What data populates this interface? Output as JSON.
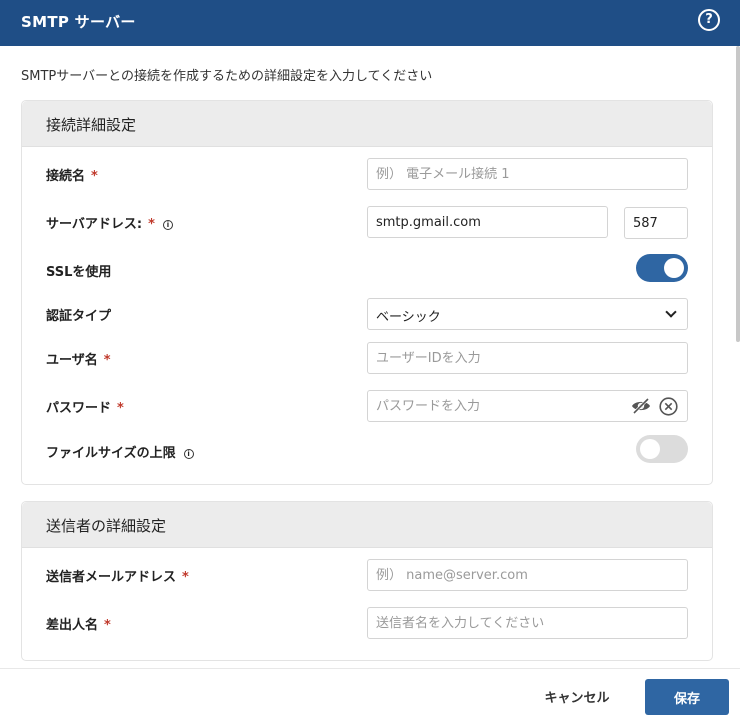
{
  "dialog": {
    "title": "SMTP サーバー",
    "help_icon": "?",
    "description": "SMTPサーバーとの接続を作成するための詳細設定を入力してください"
  },
  "connection_section": {
    "title": "接続詳細設定",
    "required_mark": "*",
    "info_mark": "i",
    "connection_name": {
      "label": "接続名",
      "placeholder": "例） 電子メール接続 1"
    },
    "server_address": {
      "label": "サーバアドレス:",
      "value": "smtp.gmail.com",
      "port": "587"
    },
    "ssl": {
      "label": "SSLを使用",
      "enabled": true
    },
    "auth_type": {
      "label": "認証タイプ",
      "value": "ベーシック"
    },
    "username": {
      "label": "ユーザ名",
      "placeholder": "ユーザーIDを入力"
    },
    "password": {
      "label": "パスワード",
      "placeholder": "パスワードを入力"
    },
    "file_size_limit": {
      "label": "ファイルサイズの上限",
      "enabled": false
    }
  },
  "sender_section": {
    "title": "送信者の詳細設定",
    "sender_email": {
      "label": "送信者メールアドレス",
      "placeholder": "例） name@server.com"
    },
    "sender_name": {
      "label": "差出人名",
      "placeholder": "送信者名を入力してください"
    }
  },
  "footer": {
    "cancel_label": "キャンセル",
    "save_label": "保存"
  },
  "colors": {
    "header_bg": "#1f4e86",
    "accent": "#2f66a3",
    "required": "#c0392b"
  },
  "icons": {
    "help": "help-icon",
    "info": "info-icon",
    "chevron": "chevron-down-icon",
    "hide_password": "eye-off-icon",
    "clear": "clear-icon"
  }
}
